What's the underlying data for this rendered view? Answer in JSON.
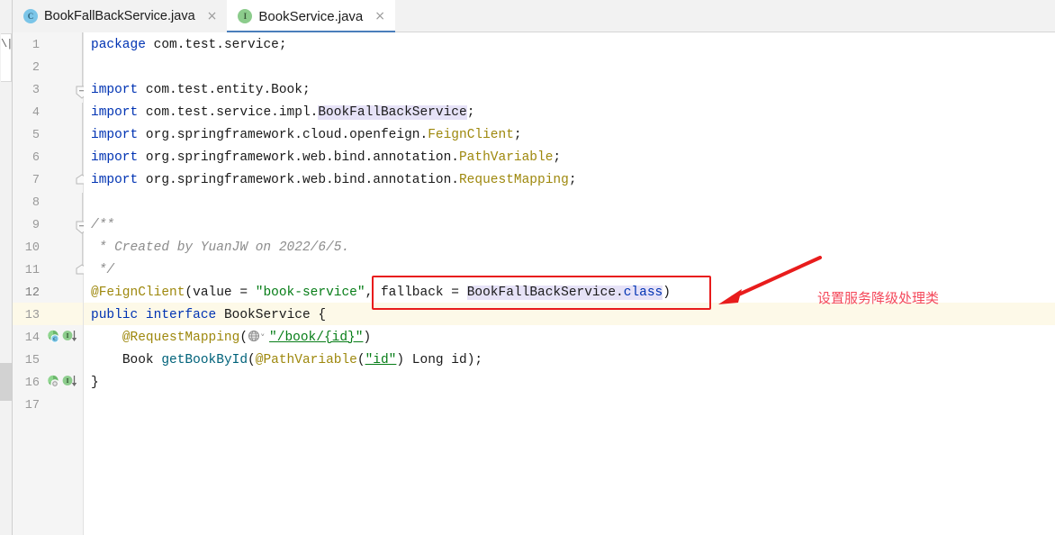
{
  "window": {
    "app": "intellij-idea-editor",
    "accent_tab_underline": "#4a7ebb",
    "current_line_highlight": "#fdf9e8"
  },
  "tabs": [
    {
      "label": "BookFallBackService.java",
      "icon": "java-class-icon",
      "icon_letter": "C",
      "icon_color": "#7bc5e8",
      "active": false,
      "close_glyph": "×"
    },
    {
      "label": "BookService.java",
      "icon": "java-interface-icon",
      "icon_letter": "I",
      "icon_color": "#8ccc8c",
      "active": true,
      "close_glyph": "×"
    }
  ],
  "gutter": {
    "line_numbers": [
      "1",
      "2",
      "3",
      "4",
      "5",
      "6",
      "7",
      "8",
      "9",
      "10",
      "11",
      "12",
      "13",
      "14",
      "15",
      "16",
      "17"
    ],
    "current_line": "12",
    "marker_lines": [
      "13",
      "15"
    ],
    "marker_names": [
      "implemented-method-icon",
      "interface-override-icon"
    ]
  },
  "code": {
    "lines": [
      {
        "n": "1",
        "text": "package com.test.service;"
      },
      {
        "n": "2",
        "text": ""
      },
      {
        "n": "3",
        "text": "import com.test.entity.Book;"
      },
      {
        "n": "4",
        "text": "import com.test.service.impl.BookFallBackService;"
      },
      {
        "n": "5",
        "text": "import org.springframework.cloud.openfeign.FeignClient;"
      },
      {
        "n": "6",
        "text": "import org.springframework.web.bind.annotation.PathVariable;"
      },
      {
        "n": "7",
        "text": "import org.springframework.web.bind.annotation.RequestMapping;"
      },
      {
        "n": "8",
        "text": ""
      },
      {
        "n": "9",
        "text": "/**"
      },
      {
        "n": "10",
        "text": " * Created by YuanJW on 2022/6/5."
      },
      {
        "n": "11",
        "text": " */"
      },
      {
        "n": "12",
        "text": "@FeignClient(value = \"book-service\", fallback = BookFallBackService.class)"
      },
      {
        "n": "13",
        "text": "public interface BookService {"
      },
      {
        "n": "14",
        "text": "    @RequestMapping(\"/book/{id}\")"
      },
      {
        "n": "15",
        "text": "    Book getBookById(@PathVariable(\"id\") Long id);"
      },
      {
        "n": "16",
        "text": "}"
      },
      {
        "n": "17",
        "text": ""
      }
    ],
    "tokens": {
      "kw_package": "package",
      "kw_import": "import",
      "kw_public": "public",
      "kw_interface": "interface",
      "kw_class": "class",
      "pkg_service": "com.test.service;",
      "imp_book": "com.test.entity.Book;",
      "imp_impl_prefix": "com.test.service.impl.",
      "imp_impl_name": "BookFallBackService",
      "imp_feign_prefix": "org.springframework.cloud.openfeign.",
      "imp_feign_name": "FeignClient",
      "imp_pathvar_prefix": "org.springframework.web.bind.annotation.",
      "imp_pathvar_name": "PathVariable",
      "imp_reqmap_prefix": "org.springframework.web.bind.annotation.",
      "imp_reqmap_name": "RequestMapping",
      "doc_open": "/**",
      "doc_body": " * Created by YuanJW on 2022/6/5.",
      "doc_close": " */",
      "anno_feign": "@FeignClient",
      "l12_open": "(value = ",
      "l12_str": "\"book-service\"",
      "l12_mid": ", fallback = ",
      "l12_id": "BookFallBackService",
      "l12_dot": ".",
      "l12_class": "class",
      "l12_close": ")",
      "l13_type": "BookService",
      "l13_brace": " {",
      "anno_reqmap": "@RequestMapping",
      "l14_paren_open": "(",
      "l14_str": "\"/book/{id}\"",
      "l14_paren_close": ")",
      "l15_booktype": "Book",
      "l15_method": "getBookById",
      "l15_open": "(",
      "anno_pathvar": "@PathVariable",
      "l15_str": "\"id\"",
      "l15_tail": ") Long id);",
      "l16_brace": "}",
      "semicolon": ";"
    }
  },
  "annotation": {
    "text": "设置服务降级处理类",
    "color": "#f4485a",
    "box_color": "#e81c1c",
    "arrow_name": "red-pointer-arrow"
  }
}
